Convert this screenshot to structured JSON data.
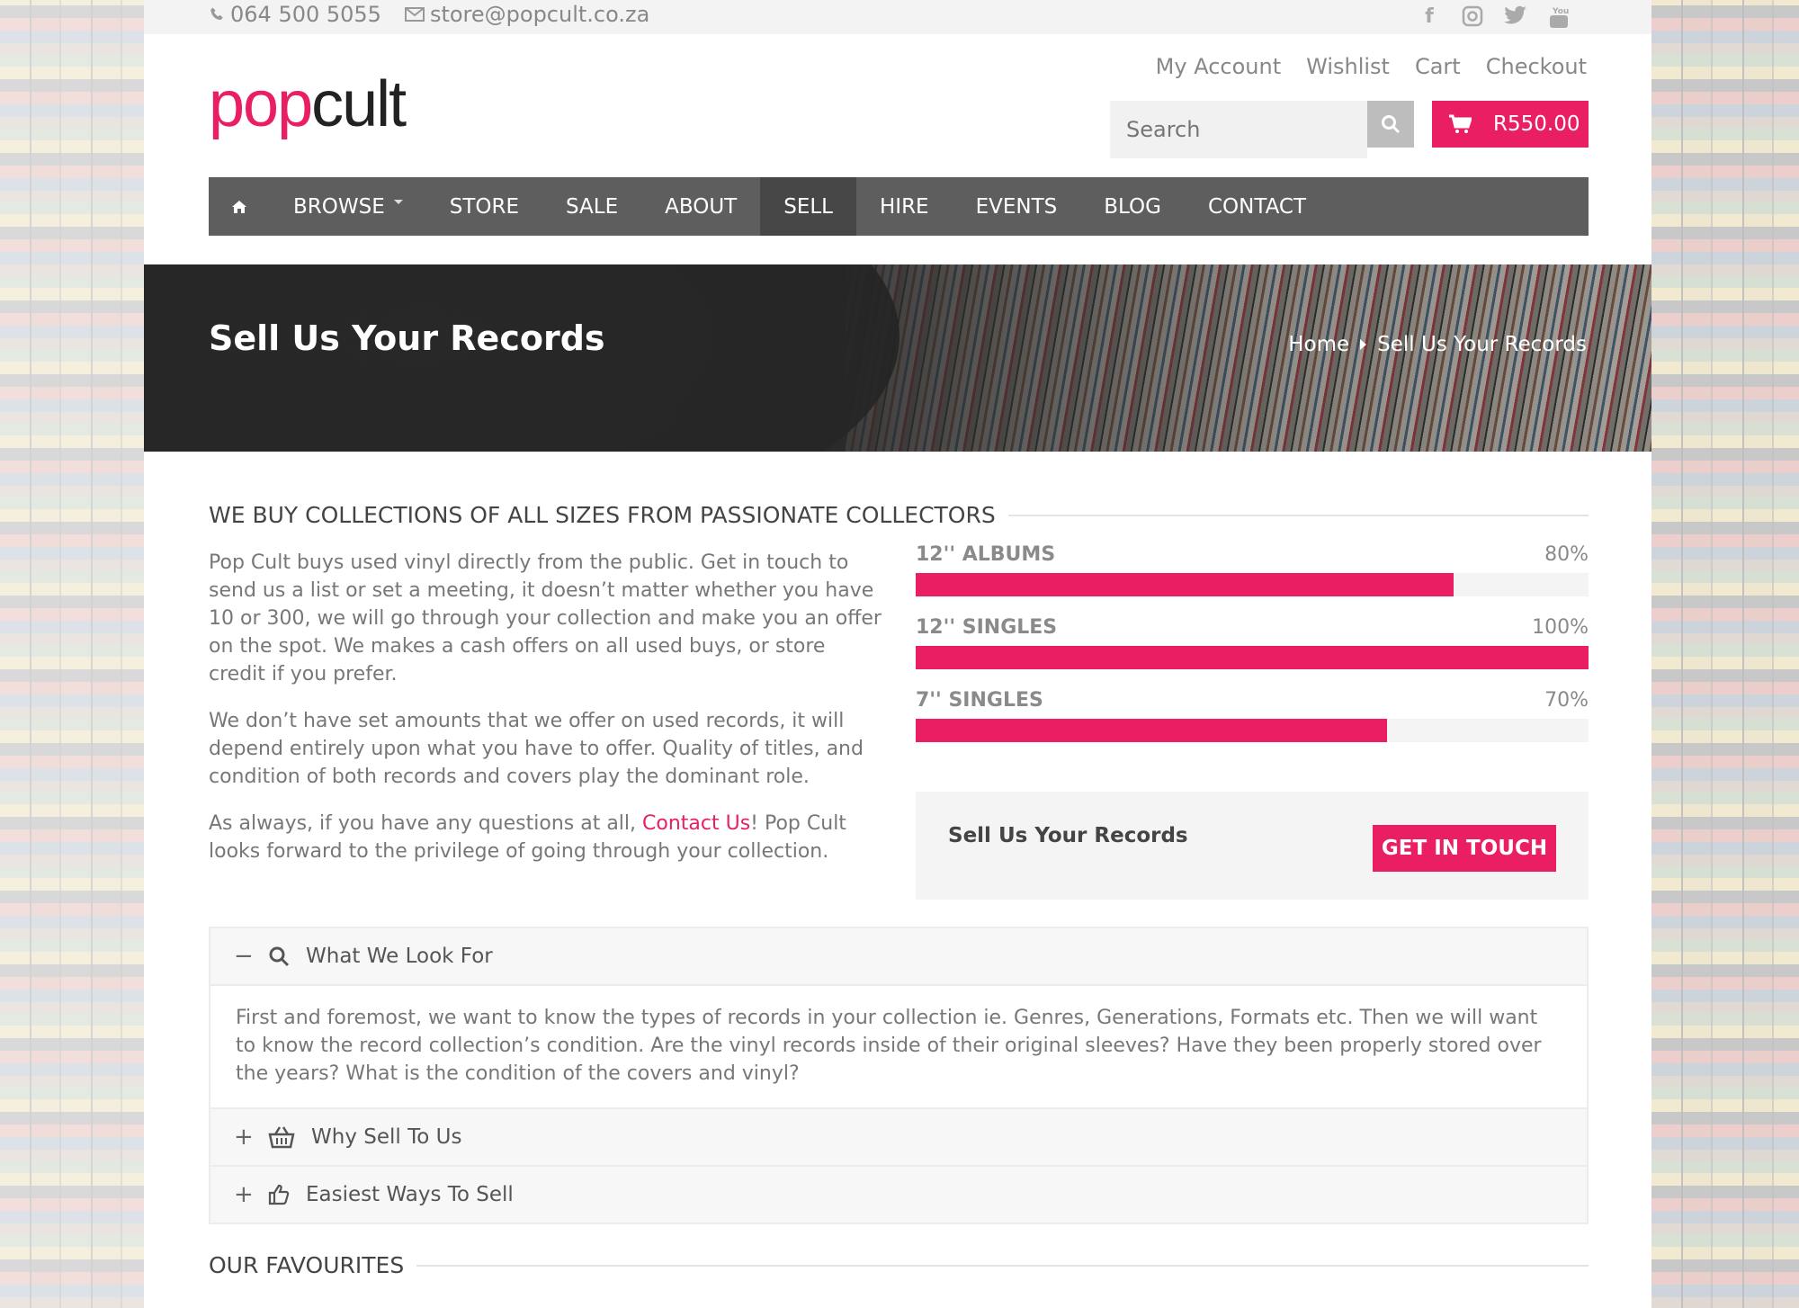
{
  "topbar": {
    "phone": "064 500 5055",
    "email": "store@popcult.co.za",
    "social": [
      "facebook-icon",
      "instagram-icon",
      "twitter-icon",
      "youtube-icon"
    ]
  },
  "logo": {
    "part1": "pop",
    "part2": "cult"
  },
  "account_links": [
    "My Account",
    "Wishlist",
    "Cart",
    "Checkout"
  ],
  "search": {
    "placeholder": "Search"
  },
  "cart": {
    "total": "R550.00"
  },
  "nav": {
    "items": [
      "BROWSE",
      "STORE",
      "SALE",
      "ABOUT",
      "SELL",
      "HIRE",
      "EVENTS",
      "BLOG",
      "CONTACT"
    ],
    "active": "SELL"
  },
  "hero": {
    "title": "Sell Us Your Records",
    "breadcrumb": [
      "Home",
      "Sell Us Your Records"
    ]
  },
  "section_title": "WE BUY COLLECTIONS OF ALL SIZES FROM PASSIONATE COLLECTORS",
  "paragraphs": {
    "p1": "Pop Cult buys used vinyl directly from the public. Get in touch to send us a list or set a meeting, it doesn’t matter  whether you have 10 or 300, we will go through your collection and make you an offer on the spot. We makes a cash offers on all used buys, or store credit if you prefer.",
    "p2": "We don’t have set amounts that we offer on used records, it will depend entirely upon what you have to offer. Quality of titles, and condition of both records and covers play the dominant role.",
    "p3_before": "As always, if you have any questions at all, ",
    "p3_link": "Contact Us",
    "p3_after": "! Pop Cult looks forward to the privilege of going through your collection."
  },
  "progress": [
    {
      "label": "12'' ALBUMS",
      "percent_text": "80%",
      "value": 0.8
    },
    {
      "label": "12'' SINGLES",
      "percent_text": "100%",
      "value": 1.0
    },
    {
      "label": "7'' SINGLES",
      "percent_text": "70%",
      "value": 0.7
    }
  ],
  "cta": {
    "text": "Sell Us Your Records",
    "button": "GET IN TOUCH"
  },
  "accordion": [
    {
      "title": "What We Look For",
      "icon": "search-icon",
      "expanded": true,
      "body": "First and foremost, we want to know the types of records in your collection ie. Genres, Generations, Formats etc. Then we will want to know the record collection’s condition. Are the vinyl records inside of their original sleeves? Have they been properly stored over the years? What is the condition of the covers and vinyl?"
    },
    {
      "title": "Why Sell To Us",
      "icon": "basket-icon",
      "expanded": false
    },
    {
      "title": "Easiest Ways To Sell",
      "icon": "thumbs-up-icon",
      "expanded": false
    }
  ],
  "favourites_title": "OUR FAVOURITES",
  "colors": {
    "accent": "#e91e63",
    "nav": "#5e5e5e",
    "nav_active": "#474747"
  }
}
